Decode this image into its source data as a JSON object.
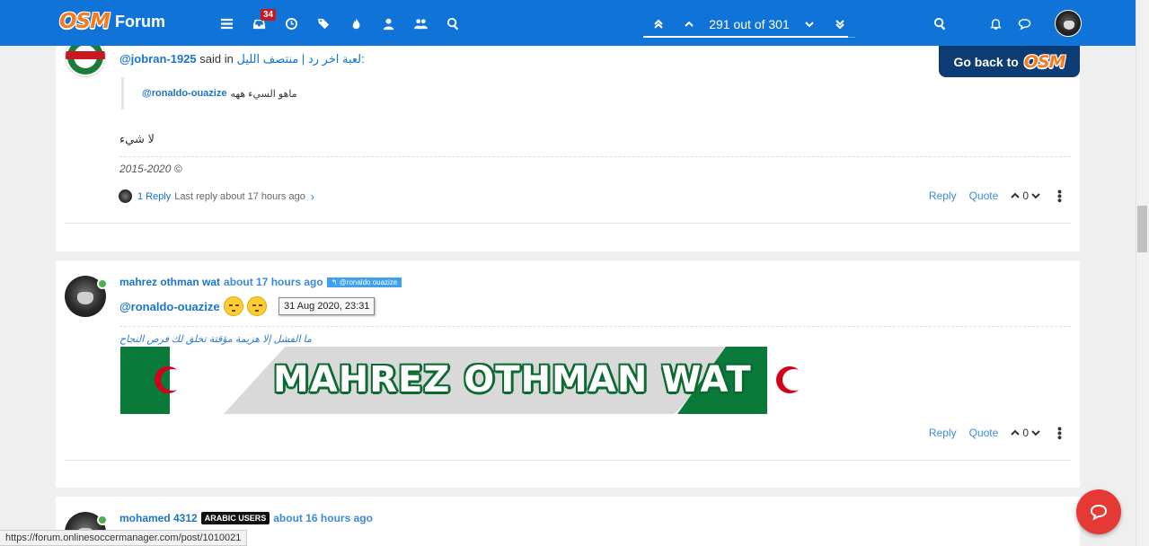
{
  "header": {
    "brand": "OSM",
    "title": "Forum",
    "notifications_count": "34",
    "nav_icons": [
      "menu-icon",
      "inbox-icon",
      "clock-icon",
      "tags-icon",
      "fire-icon",
      "user-icon",
      "users-icon",
      "search-icon"
    ],
    "pagination_text": "291 out of 301",
    "pagination_progress": 0.967,
    "right_icons": [
      "search-icon",
      "bell-icon",
      "chat-icon"
    ]
  },
  "go_back": {
    "label": "Go back to",
    "logo": "OSM"
  },
  "post1": {
    "quote_user": "@jobran-1925",
    "said_in_text": "said in",
    "topic_link": "لعبة اخر رد | منتصف الليل:",
    "quoted_mention": "@ronaldo-ouazize",
    "quoted_text": "ماهو السيء ههه",
    "body": "لا شيء",
    "signature": "2015-2020 ©",
    "replies_count": "1 Reply",
    "last_reply": "Last reply about 17 hours ago",
    "reply_label": "Reply",
    "quote_label": "Quote",
    "votes": "0"
  },
  "post2": {
    "username": "mahrez othman wat",
    "time": "about 17 hours ago",
    "reply_to": "@ronaldo ouazize",
    "mention": "@ronaldo-ouazize",
    "tooltip": "31 Aug 2020, 23:31",
    "signature": "ما الفشل إلا هزيمة مؤقتة تخلق لك فرص النجاح",
    "banner_text": "MAHREZ OTHMAN WAT",
    "reply_label": "Reply",
    "quote_label": "Quote",
    "votes": "0"
  },
  "post3": {
    "username": "mohamed 4312",
    "group_tag": "ARABIC USERS",
    "time": "about 16 hours ago"
  },
  "statusbar": {
    "url": "https://forum.onlinesoccermanager.com/post/1010021"
  },
  "colors": {
    "navbar": "#0f73d7",
    "link": "#1a74c9",
    "fab": "#e53935",
    "brand_orange": "#f47b20"
  }
}
